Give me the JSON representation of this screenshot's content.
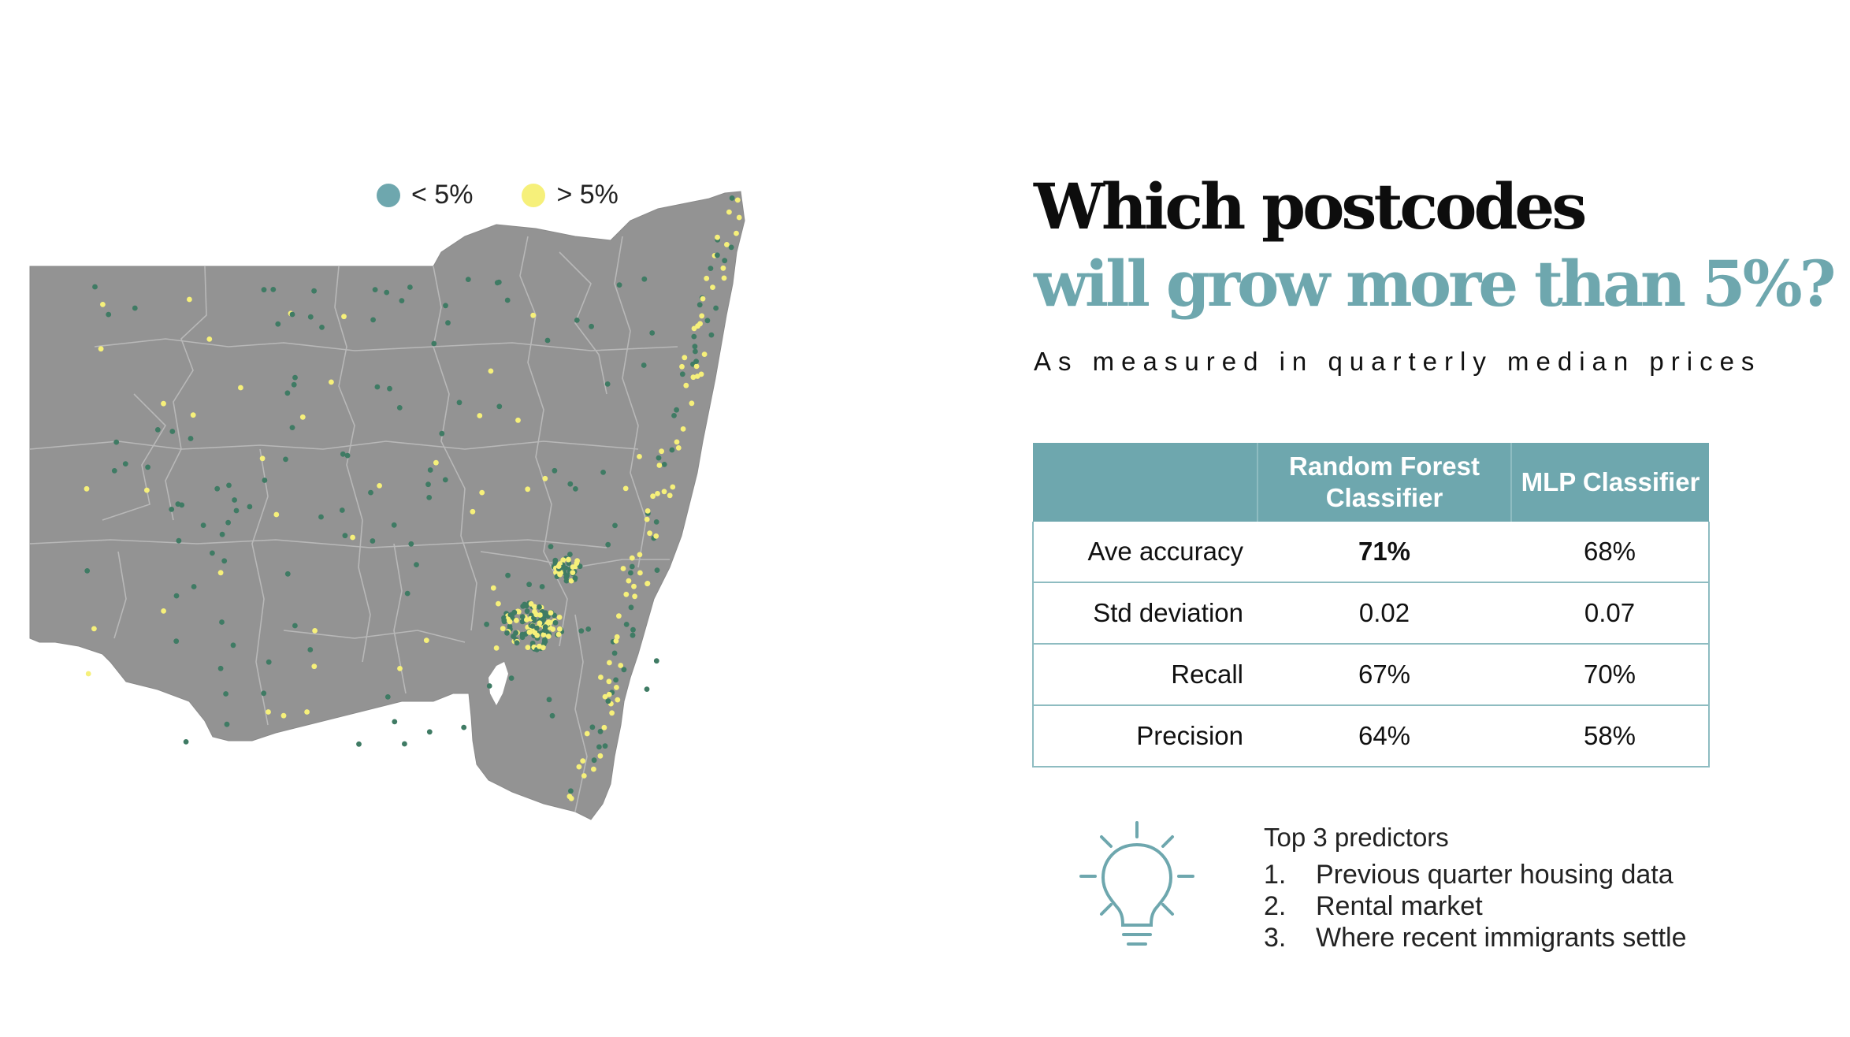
{
  "legend": {
    "items": [
      {
        "label": "< 5%",
        "color": "#6ea7ae"
      },
      {
        "label": "> 5%",
        "color": "#f6f07a"
      }
    ]
  },
  "title": {
    "line1": "Which postcodes",
    "line2": "will grow more than 5%?",
    "subtitle": "As measured in quarterly median prices"
  },
  "table": {
    "headers": [
      "",
      "Random Forest Classifier",
      "MLP Classifier"
    ],
    "rows": [
      {
        "metric": "Ave accuracy",
        "rf": "71%",
        "mlp": "68%"
      },
      {
        "metric": "Std deviation",
        "rf": "0.02",
        "mlp": "0.07"
      },
      {
        "metric": "Recall",
        "rf": "67%",
        "mlp": "70%"
      },
      {
        "metric": "Precision",
        "rf": "64%",
        "mlp": "58%"
      }
    ]
  },
  "predictors": {
    "title": "Top 3 predictors",
    "items": [
      {
        "num": "1.",
        "text": "Previous quarter housing data"
      },
      {
        "num": "2.",
        "text": "Rental market"
      },
      {
        "num": "3.",
        "text": "Where recent immigrants settle"
      }
    ]
  },
  "colors": {
    "accent": "#6ea7ae",
    "map_fill": "#939393",
    "dot_low": "#3f7b64",
    "dot_high": "#f6f07a"
  },
  "icons": {
    "predictors": "lightbulb-icon"
  }
}
